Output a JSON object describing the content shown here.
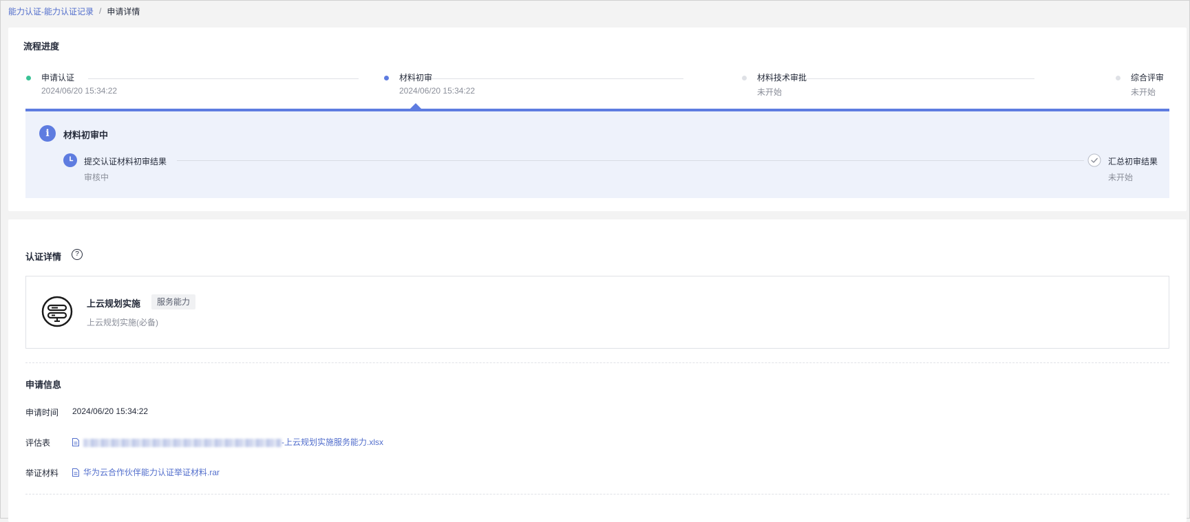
{
  "breadcrumb": {
    "parent": "能力认证-能力认证记录",
    "separator": "/",
    "current": "申请详情"
  },
  "progress": {
    "title": "流程进度",
    "steps": [
      {
        "label": "申请认证",
        "time": "2024/06/20 15:34:22",
        "state": "done",
        "color": "#3ac295"
      },
      {
        "label": "材料初审",
        "time": "2024/06/20 15:34:22",
        "state": "active",
        "color": "#5e7ce0"
      },
      {
        "label": "材料技术审批",
        "time": "未开始",
        "state": "pending",
        "color": "#dfe1e6"
      },
      {
        "label": "综合评审",
        "time": "未开始",
        "state": "pending",
        "color": "#dfe1e6"
      }
    ],
    "panel": {
      "title": "材料初审中",
      "sub_steps": [
        {
          "label": "提交认证材料初审结果",
          "status": "审核中",
          "icon": "clock-icon"
        },
        {
          "label": "汇总初审结果",
          "status": "未开始",
          "icon": "check-circle-icon"
        }
      ]
    }
  },
  "detail": {
    "title": "认证详情",
    "help_symbol": "?",
    "capability": {
      "name": "上云规划实施",
      "tag": "服务能力",
      "subtitle": "上云规划实施(必备)"
    },
    "application": {
      "title": "申请信息",
      "time_label": "申请时间",
      "time_value": "2024/06/20 15:34:22",
      "assessment_label": "评估表",
      "assessment_file": "-上云规划实施服务能力.xlsx",
      "evidence_label": "举证材料",
      "evidence_file": "华为云合作伙伴能力认证举证材料.rar"
    }
  },
  "colors": {
    "accent": "#5e7ce0",
    "link": "#526ecc",
    "success": "#3ac295",
    "panel_bg": "#eef2fb"
  }
}
